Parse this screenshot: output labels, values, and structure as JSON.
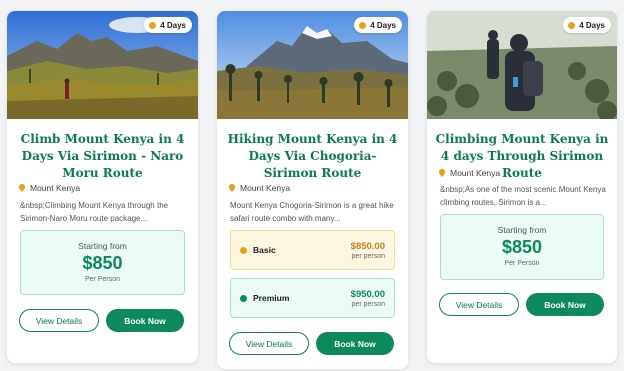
{
  "tours": [
    {
      "duration": "4 Days",
      "title": "Climb Mount Kenya in 4 Days Via Sirimon - Naro Moru Route",
      "location": "Mount Kenya",
      "description": "&nbsp;Climbing Mount Kenya through the Sirimon-Naro Moru route package...",
      "price": {
        "from_label": "Starting from",
        "amount": "$850",
        "unit": "Per Person"
      },
      "view_label": "View Details",
      "book_label": "Book Now"
    },
    {
      "duration": "4 Days",
      "title": "Hiking Mount Kenya in 4 Days Via Chogoria-Sirimon Route",
      "location": "Mount Kenya",
      "description": "Mount Kenya Chogoria-Sirimon is a great hike safari route combo with many...",
      "tiers": [
        {
          "name": "Basic",
          "amount": "$850.00",
          "unit": "per person"
        },
        {
          "name": "Premium",
          "amount": "$950.00",
          "unit": "per person"
        }
      ],
      "view_label": "View Details",
      "book_label": "Book Now"
    },
    {
      "duration": "4 Days",
      "title": "Climbing Mount Kenya in 4 days Through Sirimon Route",
      "location": "Mount Kenya",
      "description": "&nbsp;As one of the most scenic Mount Kenya climbing routes, Sirimon is a...",
      "price": {
        "from_label": "Starting from",
        "amount": "$850",
        "unit": "Per Person"
      },
      "view_label": "View Details",
      "book_label": "Book Now"
    }
  ],
  "colors": {
    "brand_green": "#0c8a5c",
    "title_green": "#0c7a54",
    "badge_dot": "#e8a21a",
    "basic_price": "#c7831a"
  }
}
